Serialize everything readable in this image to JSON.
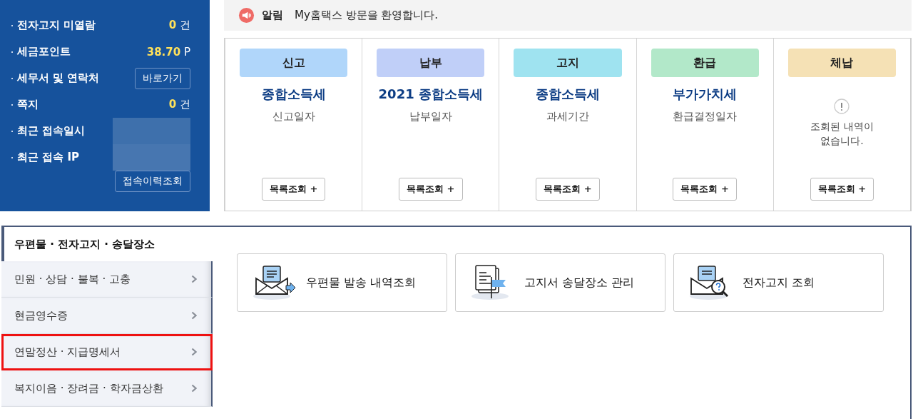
{
  "account": {
    "rows": [
      {
        "kind": "count",
        "label": "전자고지 미열람",
        "value": "0",
        "unit": "건"
      },
      {
        "kind": "count",
        "label": "세금포인트",
        "value": "38.70",
        "unit": "P"
      },
      {
        "kind": "button",
        "label": "세무서 및 연락처",
        "button": "바로가기"
      },
      {
        "kind": "count",
        "label": "쪽지",
        "value": "0",
        "unit": "건"
      },
      {
        "kind": "redacted",
        "label": "최근 접속일시"
      },
      {
        "kind": "redacted",
        "label": "최근 접속 IP"
      }
    ],
    "history_button": "접속이력조회"
  },
  "notice": {
    "label": "알림",
    "message": "My홈택스 방문을 환영합니다."
  },
  "status_cards": [
    {
      "kind": "info",
      "category": "신고",
      "color": "#b0d6fa",
      "title": "종합소득세",
      "subtitle": "신고일자",
      "button": "목록조회 +"
    },
    {
      "kind": "info",
      "category": "납부",
      "color": "#c0cff8",
      "title": "2021 종합소득세",
      "subtitle": "납부일자",
      "button": "목록조회 +"
    },
    {
      "kind": "info",
      "category": "고지",
      "color": "#9fe3f0",
      "title": "종합소득세",
      "subtitle": "과세기간",
      "button": "목록조회 +"
    },
    {
      "kind": "info",
      "category": "환급",
      "color": "#b2e8c9",
      "title": "부가가치세",
      "subtitle": "환급결정일자",
      "button": "목록조회 +"
    },
    {
      "kind": "empty",
      "category": "체납",
      "color": "#f5e1b5",
      "message": "조회된 내역이\n없습니다.",
      "button": "목록조회 +"
    }
  ],
  "menu": {
    "tabs": [
      {
        "label": "우편물 · 전자고지 · 송달장소",
        "selected": true
      },
      {
        "label": "민원 · 상담 · 불복 · 고충",
        "selected": false,
        "highlighted": false
      },
      {
        "label": "현금영수증",
        "selected": false,
        "highlighted": false
      },
      {
        "label": "연말정산 · 지급명세서",
        "selected": false,
        "highlighted": true
      },
      {
        "label": "복지이음 · 장려금 · 학자금상환",
        "selected": false,
        "highlighted": false
      }
    ],
    "services": [
      {
        "kind": "mail-send",
        "label": "우편물 발송 내역조회"
      },
      {
        "kind": "document-flag",
        "label": "고지서 송달장소 관리"
      },
      {
        "kind": "mail-search",
        "label": "전자고지 조회"
      }
    ]
  }
}
